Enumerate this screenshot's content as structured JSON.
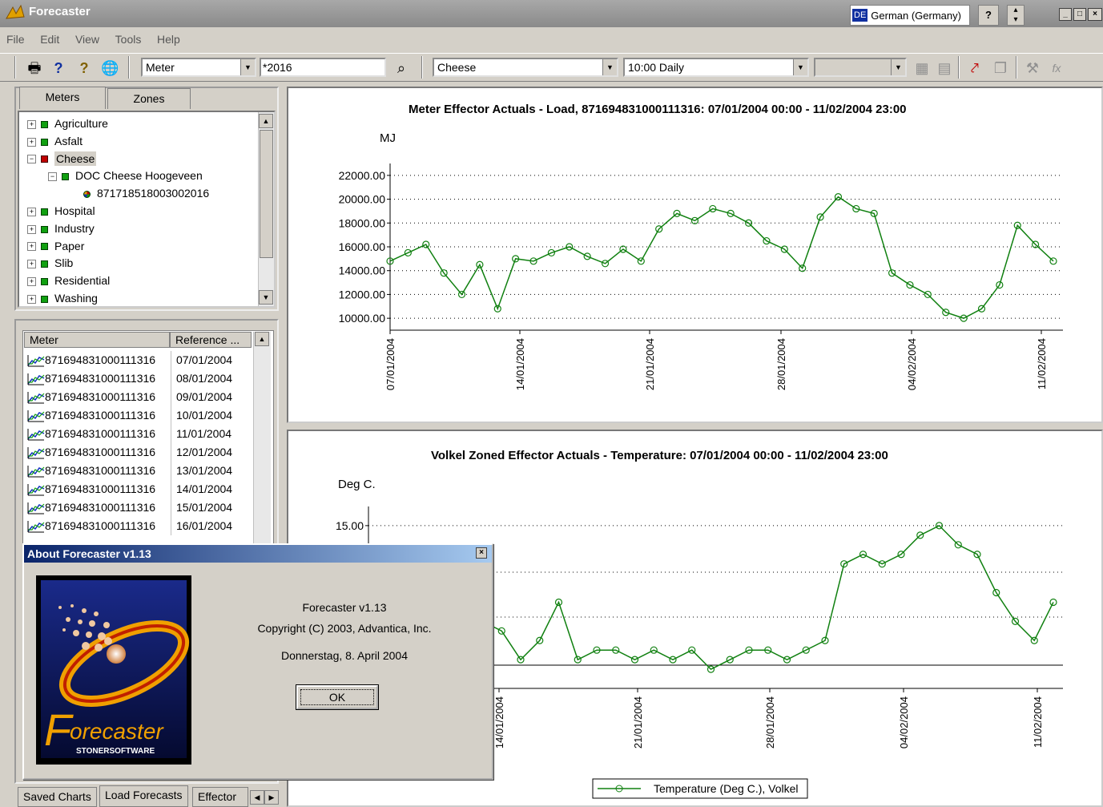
{
  "window": {
    "title": "Forecaster",
    "language": {
      "code": "DE",
      "label": "German (Germany)"
    },
    "help_glyph": "?"
  },
  "menu": [
    "File",
    "Edit",
    "View",
    "Tools",
    "Help"
  ],
  "toolbar": {
    "meter_type": "Meter",
    "search_value": "*2016",
    "group": "Cheese",
    "schedule": "10:00 Daily",
    "icons": [
      "print-icon",
      "help-icon",
      "context-help-icon",
      "globe-icon",
      "binoculars-icon",
      "grid-icon",
      "table-icon",
      "trend-icon",
      "copy-icon",
      "tools-icon",
      "function-icon"
    ]
  },
  "tree": {
    "tabs": [
      "Meters",
      "Zones"
    ],
    "items": [
      {
        "label": "Agriculture",
        "level": 0,
        "expander": "+",
        "status": "green"
      },
      {
        "label": "Asfalt",
        "level": 0,
        "expander": "+",
        "status": "green"
      },
      {
        "label": "Cheese",
        "level": 0,
        "expander": "−",
        "status": "red",
        "selected": true
      },
      {
        "label": "DOC Cheese Hoogeveen",
        "level": 1,
        "expander": "−",
        "status": "green"
      },
      {
        "label": "871718518003002016",
        "level": 2,
        "expander": "",
        "status": "meter"
      },
      {
        "label": "Hospital",
        "level": 0,
        "expander": "+",
        "status": "green"
      },
      {
        "label": "Industry",
        "level": 0,
        "expander": "+",
        "status": "green"
      },
      {
        "label": "Paper",
        "level": 0,
        "expander": "+",
        "status": "green"
      },
      {
        "label": "Slib",
        "level": 0,
        "expander": "+",
        "status": "green"
      },
      {
        "label": "Residential",
        "level": 0,
        "expander": "+",
        "status": "green"
      },
      {
        "label": "Washing",
        "level": 0,
        "expander": "+",
        "status": "green"
      }
    ]
  },
  "list": {
    "columns": [
      "Meter",
      "Reference ..."
    ],
    "rows": [
      [
        "871694831000111316",
        "07/01/2004"
      ],
      [
        "871694831000111316",
        "08/01/2004"
      ],
      [
        "871694831000111316",
        "09/01/2004"
      ],
      [
        "871694831000111316",
        "10/01/2004"
      ],
      [
        "871694831000111316",
        "11/01/2004"
      ],
      [
        "871694831000111316",
        "12/01/2004"
      ],
      [
        "871694831000111316",
        "13/01/2004"
      ],
      [
        "871694831000111316",
        "14/01/2004"
      ],
      [
        "871694831000111316",
        "15/01/2004"
      ],
      [
        "871694831000111316",
        "16/01/2004"
      ]
    ]
  },
  "bottom_tabs": [
    "Saved Charts",
    "Load Forecasts",
    "Effector"
  ],
  "about": {
    "title": "About Forecaster v1.13",
    "product": "Forecaster v1.13",
    "copyright": "Copyright (C) 2003, Advantica, Inc.",
    "date": "Donnerstag, 8. April 2004",
    "ok_label": "OK",
    "logo_text": "orecaster",
    "logo_letter": "F",
    "logo_sub": "STONERSOFTWARE"
  },
  "chart_data": [
    {
      "type": "line",
      "title": "Meter Effector Actuals - Load, 871694831000111316:  07/01/2004 00:00 - 11/02/2004 23:00",
      "ylabel": "MJ",
      "yticks": [
        "22000.00",
        "20000.00",
        "18000.00",
        "16000.00",
        "14000.00",
        "12000.00",
        "10000.00"
      ],
      "ylim": [
        9000,
        23000
      ],
      "grid": true,
      "xlabels": [
        "07/01/2004",
        "14/01/2004",
        "21/01/2004",
        "28/01/2004",
        "04/02/2004",
        "11/02/2004"
      ],
      "x": [
        0,
        1,
        2,
        3,
        4,
        5,
        6,
        7,
        8,
        9,
        10,
        11,
        12,
        13,
        14,
        15,
        16,
        17,
        18,
        19,
        20,
        21,
        22,
        23,
        24,
        25,
        26,
        27,
        28,
        29,
        30,
        31,
        32,
        33,
        34,
        35,
        36
      ],
      "values": [
        14800,
        15500,
        16200,
        13800,
        12000,
        14500,
        10800,
        15000,
        14800,
        15500,
        16000,
        15200,
        14600,
        15800,
        14800,
        17500,
        18800,
        18200,
        19200,
        18800,
        18000,
        16500,
        15800,
        14200,
        18500,
        20200,
        19200,
        18800,
        13800,
        12800,
        12000,
        10500,
        10000,
        10800,
        12800,
        17800,
        16200,
        14800
      ],
      "color": "#108010",
      "legend": ""
    },
    {
      "type": "line",
      "title": "Volkel Zoned Effector Actuals - Temperature: 07/01/2004 00:00 - 11/02/2004 23:00",
      "ylabel": "Deg C.",
      "yticks": [
        "15.00"
      ],
      "ylim": [
        -2,
        17
      ],
      "grid": true,
      "xlabels": [
        "14/01/2004",
        "21/01/2004",
        "28/01/2004",
        "04/02/2004",
        "11/02/2004"
      ],
      "x": [
        0,
        1,
        2,
        3,
        4,
        5,
        6,
        7,
        8,
        9,
        10,
        11,
        12,
        13,
        14,
        15,
        16,
        17,
        18,
        19,
        20,
        21,
        22,
        23,
        24,
        25,
        26,
        27,
        28,
        29,
        30,
        31,
        32,
        33,
        34,
        35,
        36
      ],
      "values": [
        7,
        10,
        6,
        5,
        3,
        6,
        5,
        4,
        1,
        3,
        7,
        1,
        2,
        2,
        1,
        2,
        1,
        2,
        0,
        1,
        2,
        2,
        1,
        2,
        3,
        11,
        12,
        11,
        12,
        14,
        15,
        13,
        12,
        8,
        5,
        3,
        7
      ],
      "color": "#108010",
      "legend": "Temperature (Deg C.), Volkel"
    }
  ]
}
